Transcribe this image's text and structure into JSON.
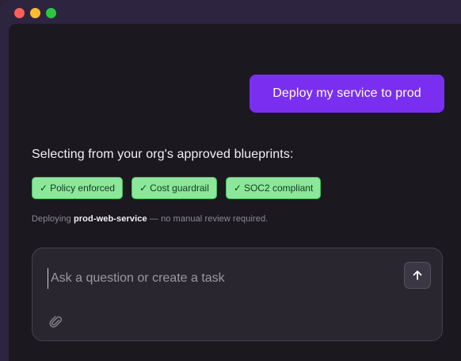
{
  "chat": {
    "user_message": "Deploy my service to prod",
    "assistant": {
      "heading": "Selecting from your org's approved blueprints:",
      "badges": [
        {
          "icon": "checkmark",
          "label": "Policy enforced"
        },
        {
          "icon": "checkmark",
          "label": "Cost guardrail"
        },
        {
          "icon": "checkmark",
          "label": "SOC2 compliant"
        }
      ],
      "deploy_prefix": "Deploying",
      "service_name": "prod-web-service",
      "deploy_suffix": "— no manual review required."
    }
  },
  "composer": {
    "placeholder": "Ask a question or create a task",
    "value": "",
    "send_icon": "arrow-up",
    "attach_icon": "paperclip"
  },
  "colors": {
    "accent": "#7a2ff0",
    "badge_bg": "#8de79b",
    "badge_border": "#3fbf5c",
    "panel_bg": "#1b181f"
  }
}
